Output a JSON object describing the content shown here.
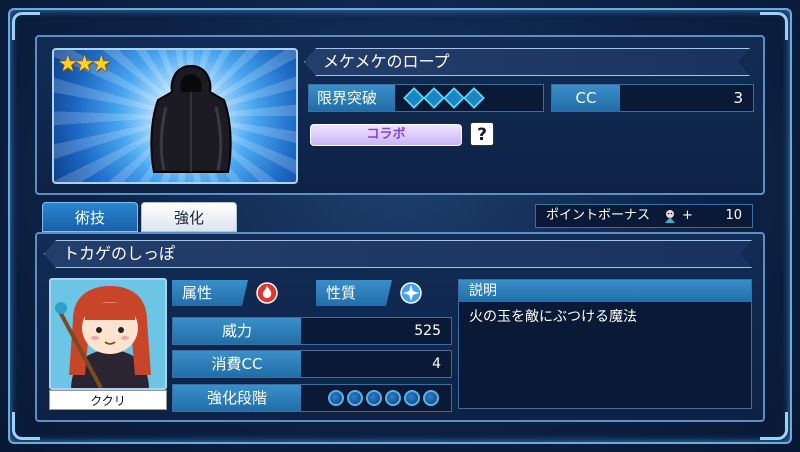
{
  "item": {
    "name": "メケメケのロープ",
    "stars": "★★★",
    "limit_label": "限界突破",
    "limit_gems": 4,
    "cc_label": "CC",
    "cc_value": "3",
    "collab_label": "コラボ",
    "help_label": "?"
  },
  "tabs": {
    "active": "術技",
    "inactive": "強化"
  },
  "bonus": {
    "label": "ポイントボーナス",
    "plus": "+",
    "value": "10"
  },
  "skill": {
    "name": "トカゲのしっぽ",
    "character": "ククリ",
    "attribute_label": "属性",
    "nature_label": "性質",
    "power_label": "威力",
    "power_value": "525",
    "cost_label": "消費CC",
    "cost_value": "4",
    "enhance_label": "強化段階",
    "enhance_slots": 6,
    "desc_title": "説明",
    "desc_text": "火の玉を敵にぶつける魔法"
  },
  "colors": {
    "accent": "#2b86d2",
    "fire": "#e0362c",
    "water": "#3aa6f0"
  }
}
